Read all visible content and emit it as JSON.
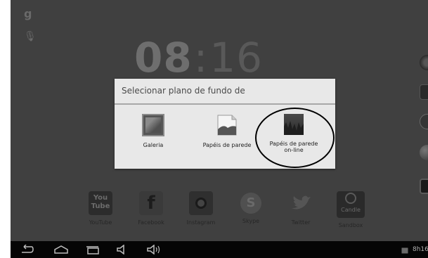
{
  "clock": {
    "hours": "08",
    "separator": ":",
    "minutes": "16"
  },
  "dialog": {
    "title": "Selecionar plano de fundo de",
    "options": [
      {
        "label": "Galeria",
        "icon": "gallery-icon"
      },
      {
        "label": "Papéis de parede",
        "icon": "wallpapers-icon"
      },
      {
        "label_line1": "Papéis de parede",
        "label_line2": "on-line",
        "icon": "online-wallpapers-icon"
      }
    ]
  },
  "apps": [
    {
      "label": "YouTube",
      "icon_text": "You Tube",
      "icon": "youtube-icon"
    },
    {
      "label": "Facebook",
      "icon_text": "f",
      "icon": "facebook-icon"
    },
    {
      "label": "Instagram",
      "icon": "instagram-icon"
    },
    {
      "label": "Skype",
      "icon_text": "S",
      "icon": "skype-icon"
    },
    {
      "label": "Twitter",
      "icon": "twitter-icon"
    },
    {
      "label": "Sandbox",
      "icon_text": "Candle",
      "icon": "candle-icon"
    }
  ],
  "status": {
    "time": "8h16"
  },
  "colors": {
    "screen_bg": "#404040",
    "dialog_bg": "#e8e8e8",
    "nav_bar": "#050505"
  }
}
